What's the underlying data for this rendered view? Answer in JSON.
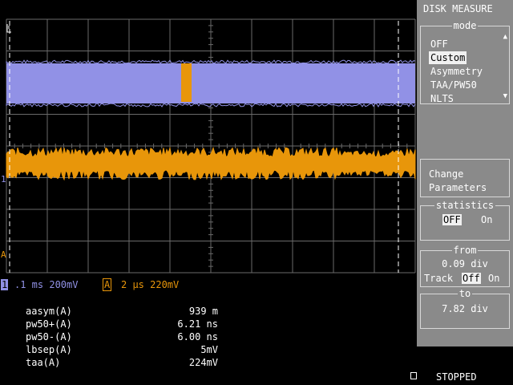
{
  "menu": {
    "title": "DISK MEASURE",
    "mode_label": "mode",
    "mode_items": [
      "OFF",
      "Custom",
      "Asymmetry",
      "TAA/PW50",
      "NLTS"
    ],
    "mode_selected": "Custom",
    "change_params_line1": "Change",
    "change_params_line2": "Parameters",
    "statistics_label": "statistics",
    "statistics_off": "OFF",
    "statistics_on": "On",
    "from_label": "from",
    "from_value": "0.09 div",
    "track_label": "Track",
    "track_off": "Off",
    "track_on": "On",
    "to_label": "to",
    "to_value": "7.82 div"
  },
  "channels": {
    "ch1_marker": "1",
    "ch1_scale": ".1 ms 200mV",
    "chA_marker": "A",
    "chA_scale": "2 µs 220mV",
    "ch1_color": "#9191e6",
    "chA_color": "#e8960a"
  },
  "measurements": [
    {
      "name": "aasym(A)",
      "value": "939 m"
    },
    {
      "name": "pw50+(A)",
      "value": "6.21 ns"
    },
    {
      "name": "pw50-(A)",
      "value": "6.00 ns"
    },
    {
      "name": "lbsep(A)",
      "value": "5mV"
    },
    {
      "name": "taa(A)",
      "value": "224mV"
    }
  ],
  "status": {
    "text": "STOPPED"
  }
}
